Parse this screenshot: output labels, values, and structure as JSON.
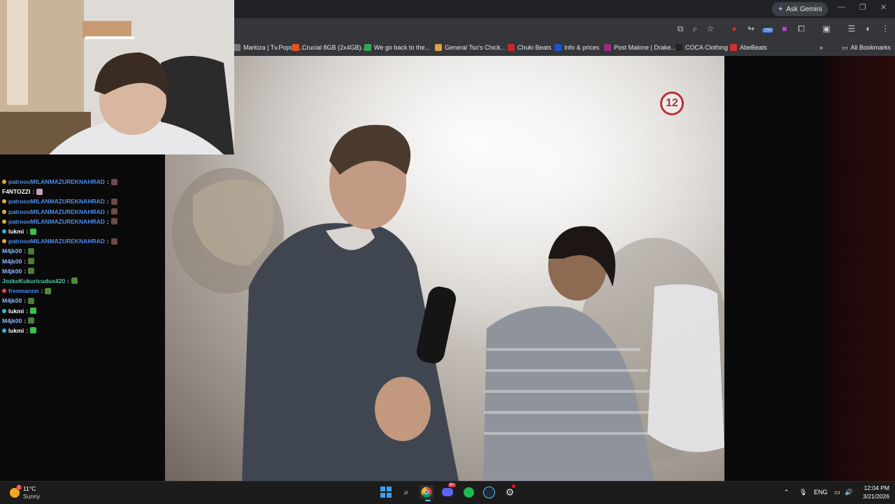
{
  "browser": {
    "ask_gemini_label": "Ask Gemini",
    "bookmarks": [
      {
        "label": "Markiza | Tv.Popcor...",
        "color": "#777777"
      },
      {
        "label": "Crucial 8GB (2x4GB)...",
        "color": "#e8541e"
      },
      {
        "label": "We go back to the...",
        "color": "#34a853"
      },
      {
        "label": "General Tso's Chick...",
        "color": "#d9a441"
      },
      {
        "label": "Chuki Beats",
        "color": "#c62828"
      },
      {
        "label": "Info & prices",
        "color": "#1a53d6"
      },
      {
        "label": "Post Malone | Drake...",
        "color": "#9b2d7c"
      },
      {
        "label": "COCA Clothing",
        "color": "#222222"
      },
      {
        "label": "AbeBeats",
        "color": "#d32f2f"
      }
    ],
    "all_bookmarks_label": "All Bookmarks",
    "extension_badge": "150"
  },
  "video": {
    "channel_logo": "12"
  },
  "chat": [
    {
      "user": "patroooMILANMAZUREKNAHRAD",
      "color": "#4a8df0",
      "badge": "#e6a93c",
      "emote": "#6b4a4a"
    },
    {
      "user": "F4NTOZZI",
      "color": "#ffffff",
      "badge": "",
      "emote": "#c9a0b4"
    },
    {
      "user": "patroooMILANMAZUREKNAHRAD",
      "color": "#4a8df0",
      "badge": "#e6a93c",
      "emote": "#6b4a4a"
    },
    {
      "user": "patroooMILANMAZUREKNAHRAD",
      "color": "#4a8df0",
      "badge": "#e6a93c",
      "emote": "#6b4a4a"
    },
    {
      "user": "patroooMILANMAZUREKNAHRAD",
      "color": "#4a8df0",
      "badge": "#e6a93c",
      "emote": "#6b4a4a"
    },
    {
      "user": "lukmi",
      "color": "#ffffff",
      "badge": "#2fb7e9",
      "emote": "#39c04a"
    },
    {
      "user": "patroooMILANMAZUREKNAHRAD",
      "color": "#4a8df0",
      "badge": "#e6a93c",
      "emote": "#6b4a4a"
    },
    {
      "user": "M4jk00",
      "color": "#8fb6ff",
      "badge": "",
      "emote": "#4f7a3a"
    },
    {
      "user": "M4jk00",
      "color": "#8fb6ff",
      "badge": "",
      "emote": "#4f7a3a"
    },
    {
      "user": "M4jk00",
      "color": "#8fb6ff",
      "badge": "",
      "emote": "#4f7a3a"
    },
    {
      "user": "JozkoKukuricudus420",
      "color": "#4ec9a6",
      "badge": "",
      "emote": "#4f8a3a"
    },
    {
      "user": "freemannn",
      "color": "#4a8df0",
      "badge": "#e0415a",
      "emote": "#4f8a3a"
    },
    {
      "user": "M4jk00",
      "color": "#8fb6ff",
      "badge": "",
      "emote": "#4f7a3a"
    },
    {
      "user": "lukmi",
      "color": "#ffffff",
      "badge": "#2fb7e9",
      "emote": "#39c04a"
    },
    {
      "user": "M4jk00",
      "color": "#8fb6ff",
      "badge": "",
      "emote": "#4f7a3a"
    },
    {
      "user": "lukmi",
      "color": "#ffffff",
      "badge": "#2fb7e9",
      "emote": "#39c04a"
    }
  ],
  "taskbar": {
    "weather_temp": "11°C",
    "weather_desc": "Sunny",
    "weather_badge": "2",
    "discord_badge": "9+",
    "language": "ENG",
    "time": "12:04 PM",
    "date": "3/21/2026"
  }
}
